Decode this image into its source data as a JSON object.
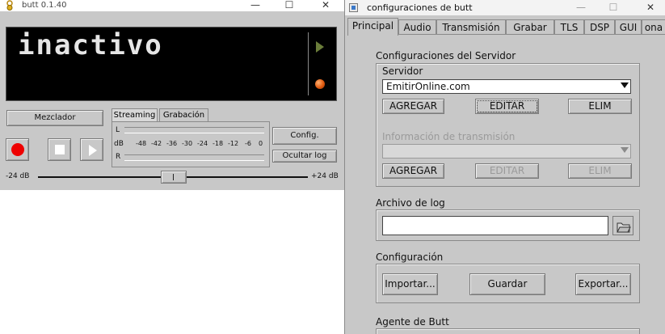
{
  "butt": {
    "window_title": "butt 0.1.40",
    "lcd_status": "inactivo",
    "mixer_label": "Mezclador",
    "tabs": [
      "Streaming",
      "Grabación"
    ],
    "meter": {
      "left_label": "L",
      "db_label": "dB",
      "right_label": "R",
      "ticks": [
        "-48",
        "-42",
        "-36",
        "-30",
        "-24",
        "-18",
        "-12",
        "-6",
        "0"
      ]
    },
    "config_label": "Config.",
    "hide_log_label": "Ocultar log",
    "volume": {
      "min_label": "-24 dB",
      "max_label": "+24 dB"
    },
    "window_controls": {
      "minimize": "—",
      "maximize": "☐",
      "close": "✕"
    }
  },
  "config": {
    "window_title": "configuraciones de butt",
    "tabs": [
      "Principal",
      "Audio",
      "Transmisión",
      "Grabar",
      "TLS",
      "DSP",
      "GUI",
      "ona"
    ],
    "active_tab": "Principal",
    "server_group": {
      "title": "Configuraciones del Servidor",
      "server_label": "Servidor",
      "server_value": "EmitirOnline.com",
      "add_label": "AGREGAR",
      "edit_label": "EDITAR",
      "delete_label": "ELIM"
    },
    "stream_info_group": {
      "title": "Información de transmisión",
      "value": "",
      "add_label": "AGREGAR",
      "edit_label": "EDITAR",
      "delete_label": "ELIM"
    },
    "log_group": {
      "title": "Archivo de log",
      "value": ""
    },
    "config_group": {
      "title": "Configuración",
      "import_label": "Importar...",
      "save_label": "Guardar",
      "export_label": "Exportar..."
    },
    "agent_group": {
      "title": "Agente de Butt"
    },
    "window_controls": {
      "minimize": "—",
      "maximize": "☐",
      "close": "✕"
    }
  }
}
